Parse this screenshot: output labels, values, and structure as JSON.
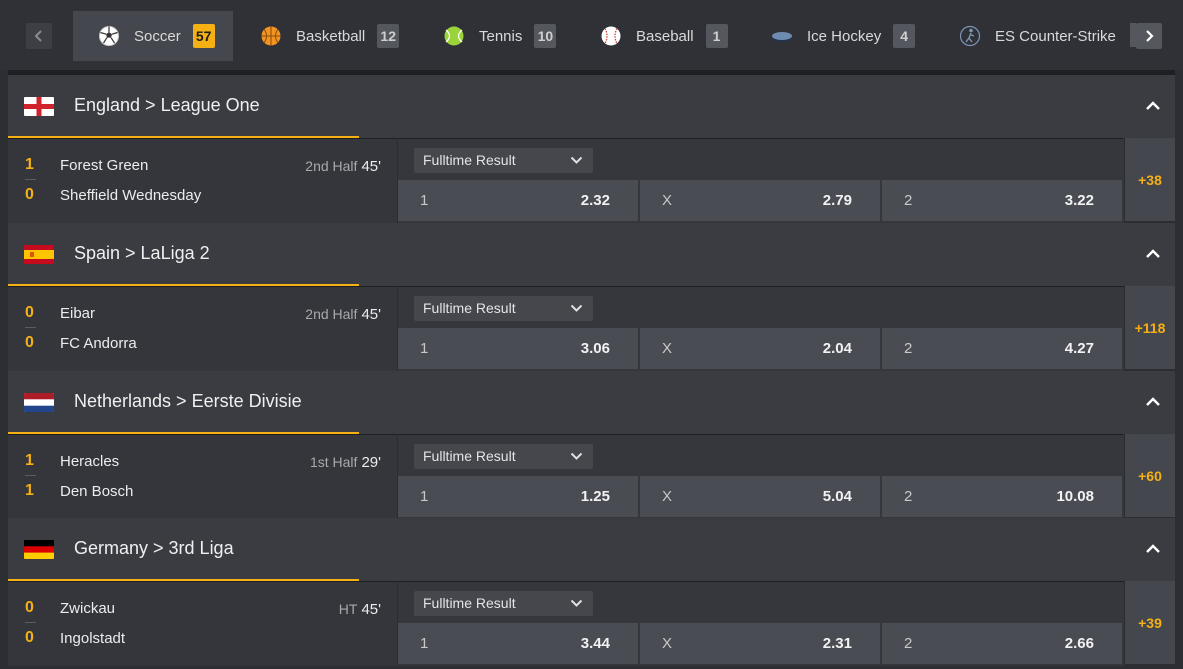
{
  "sports_nav": {
    "prev_icon": "chevron-left-icon",
    "next_icon": "chevron-right-icon",
    "tabs": [
      {
        "label": "Soccer",
        "count": "57",
        "icon": "soccer-ball-icon",
        "active": true
      },
      {
        "label": "Basketball",
        "count": "12",
        "icon": "basketball-icon"
      },
      {
        "label": "Tennis",
        "count": "10",
        "icon": "tennis-ball-icon"
      },
      {
        "label": "Baseball",
        "count": "1",
        "icon": "baseball-icon"
      },
      {
        "label": "Ice Hockey",
        "count": "4",
        "icon": "hockey-puck-icon"
      },
      {
        "label": "ES Counter-Strike",
        "count": "",
        "icon": "esports-player-icon"
      }
    ]
  },
  "colors": {
    "accent": "#f5b014",
    "background": "#2c2e34",
    "header": "#3a3c42",
    "odd_button": "#4a4c53"
  },
  "leagues": [
    {
      "title": "England > League One",
      "flag": "england-flag-icon",
      "match": {
        "home": "Forest Green",
        "away": "Sheffield Wednesday",
        "home_score": "1",
        "away_score": "0",
        "period": "2nd Half",
        "minute": "45'",
        "market": "Fulltime Result",
        "odds": [
          {
            "label": "1",
            "value": "2.32"
          },
          {
            "label": "X",
            "value": "2.79"
          },
          {
            "label": "2",
            "value": "3.22"
          }
        ],
        "more": "+38"
      }
    },
    {
      "title": "Spain > LaLiga 2",
      "flag": "spain-flag-icon",
      "match": {
        "home": "Eibar",
        "away": "FC Andorra",
        "home_score": "0",
        "away_score": "0",
        "period": "2nd Half",
        "minute": "45'",
        "market": "Fulltime Result",
        "odds": [
          {
            "label": "1",
            "value": "3.06"
          },
          {
            "label": "X",
            "value": "2.04"
          },
          {
            "label": "2",
            "value": "4.27"
          }
        ],
        "more": "+118"
      }
    },
    {
      "title": "Netherlands > Eerste Divisie",
      "flag": "netherlands-flag-icon",
      "match": {
        "home": "Heracles",
        "away": "Den Bosch",
        "home_score": "1",
        "away_score": "1",
        "period": "1st Half",
        "minute": "29'",
        "market": "Fulltime Result",
        "odds": [
          {
            "label": "1",
            "value": "1.25"
          },
          {
            "label": "X",
            "value": "5.04"
          },
          {
            "label": "2",
            "value": "10.08"
          }
        ],
        "more": "+60"
      }
    },
    {
      "title": "Germany > 3rd Liga",
      "flag": "germany-flag-icon",
      "match": {
        "home": "Zwickau",
        "away": "Ingolstadt",
        "home_score": "0",
        "away_score": "0",
        "period": "HT",
        "minute": "45'",
        "market": "Fulltime Result",
        "odds": [
          {
            "label": "1",
            "value": "3.44"
          },
          {
            "label": "X",
            "value": "2.31"
          },
          {
            "label": "2",
            "value": "2.66"
          }
        ],
        "more": "+39"
      }
    }
  ]
}
